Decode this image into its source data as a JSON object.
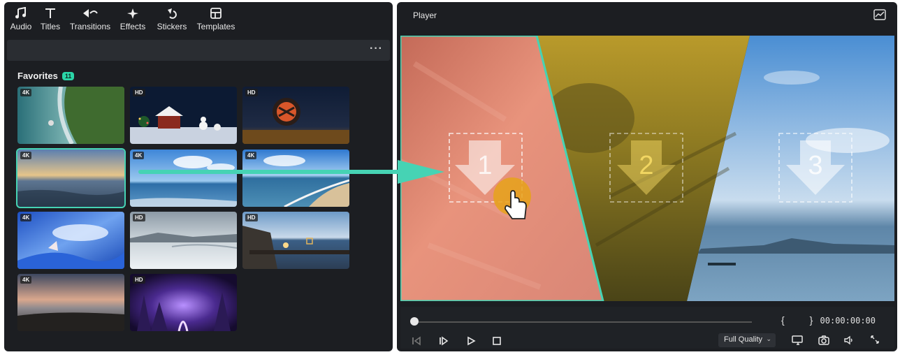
{
  "toolbar": {
    "items": [
      {
        "label": "Audio",
        "icon": "music-note-icon"
      },
      {
        "label": "Titles",
        "icon": "text-t-icon"
      },
      {
        "label": "Transitions",
        "icon": "transition-arrows-icon"
      },
      {
        "label": "Effects",
        "icon": "sparkle-icon"
      },
      {
        "label": "Stickers",
        "icon": "sticker-icon"
      },
      {
        "label": "Templates",
        "icon": "template-grid-icon"
      }
    ],
    "more_label": "···"
  },
  "favorites": {
    "title": "Favorites",
    "count": "11",
    "items": [
      {
        "badge": "4K",
        "scene": "aerial-coast"
      },
      {
        "badge": "HD",
        "scene": "christmas-night"
      },
      {
        "badge": "HD",
        "scene": "lantern-dusk"
      },
      {
        "badge": "4K",
        "scene": "sunset-sea",
        "selected": true
      },
      {
        "badge": "4K",
        "scene": "blue-sky-sea"
      },
      {
        "badge": "4K",
        "scene": "beach-waves"
      },
      {
        "badge": "4K",
        "scene": "blue-abstract"
      },
      {
        "badge": "HD",
        "scene": "snow-field"
      },
      {
        "badge": "HD",
        "scene": "pier-sunset"
      },
      {
        "badge": "4K",
        "scene": "dusk-landscape"
      },
      {
        "badge": "HD",
        "scene": "neon-forest"
      }
    ]
  },
  "player": {
    "title": "Player",
    "slots": [
      "1",
      "2",
      "3"
    ],
    "braces": "{ }",
    "timecode": "00:00:00:00",
    "quality": "Full Quality",
    "colors": {
      "accent": "#46d3b4",
      "panel": "#1c1e22"
    }
  }
}
